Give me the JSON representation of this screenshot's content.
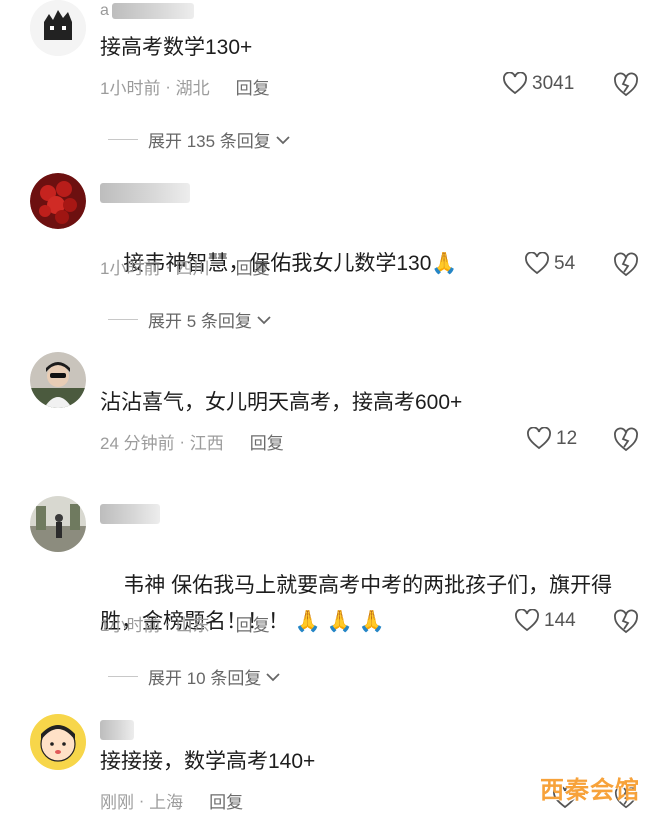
{
  "comments": [
    {
      "username": "a",
      "text": "接高考数学130+",
      "time": "1小时前",
      "location": "湖北",
      "reply_label": "回复",
      "likes": "3041",
      "expand": "展开 135 条回复"
    },
    {
      "username": "",
      "text": "接韦神智慧，保佑我女儿数学130",
      "time": "1小时前",
      "location": "四川",
      "reply_label": "回复",
      "likes": "54",
      "expand": "展开 5 条回复"
    },
    {
      "username": "",
      "text": "沾沾喜气，女儿明天高考，接高考600+",
      "time": "24 分钟前",
      "location": "江西",
      "reply_label": "回复",
      "likes": "12",
      "expand": ""
    },
    {
      "username": "",
      "text": "韦神 保佑我马上就要高考中考的两批孩子们，旗开得胜，金榜题名！！！",
      "time": "1小时前",
      "location": "山东",
      "reply_label": "回复",
      "likes": "144",
      "expand": "展开 10 条回复"
    },
    {
      "username": "",
      "text": "接接接，数学高考140+",
      "time": "刚刚",
      "location": "上海",
      "reply_label": "回复",
      "likes": "",
      "expand": ""
    }
  ],
  "watermark": "西秦会馆",
  "colors": {
    "meta": "#9c9c9c",
    "watermark": "#f7a23a"
  },
  "icons": [
    "heart-icon",
    "broken-heart-icon",
    "chevron-down-icon",
    "praying-hands-emoji"
  ]
}
